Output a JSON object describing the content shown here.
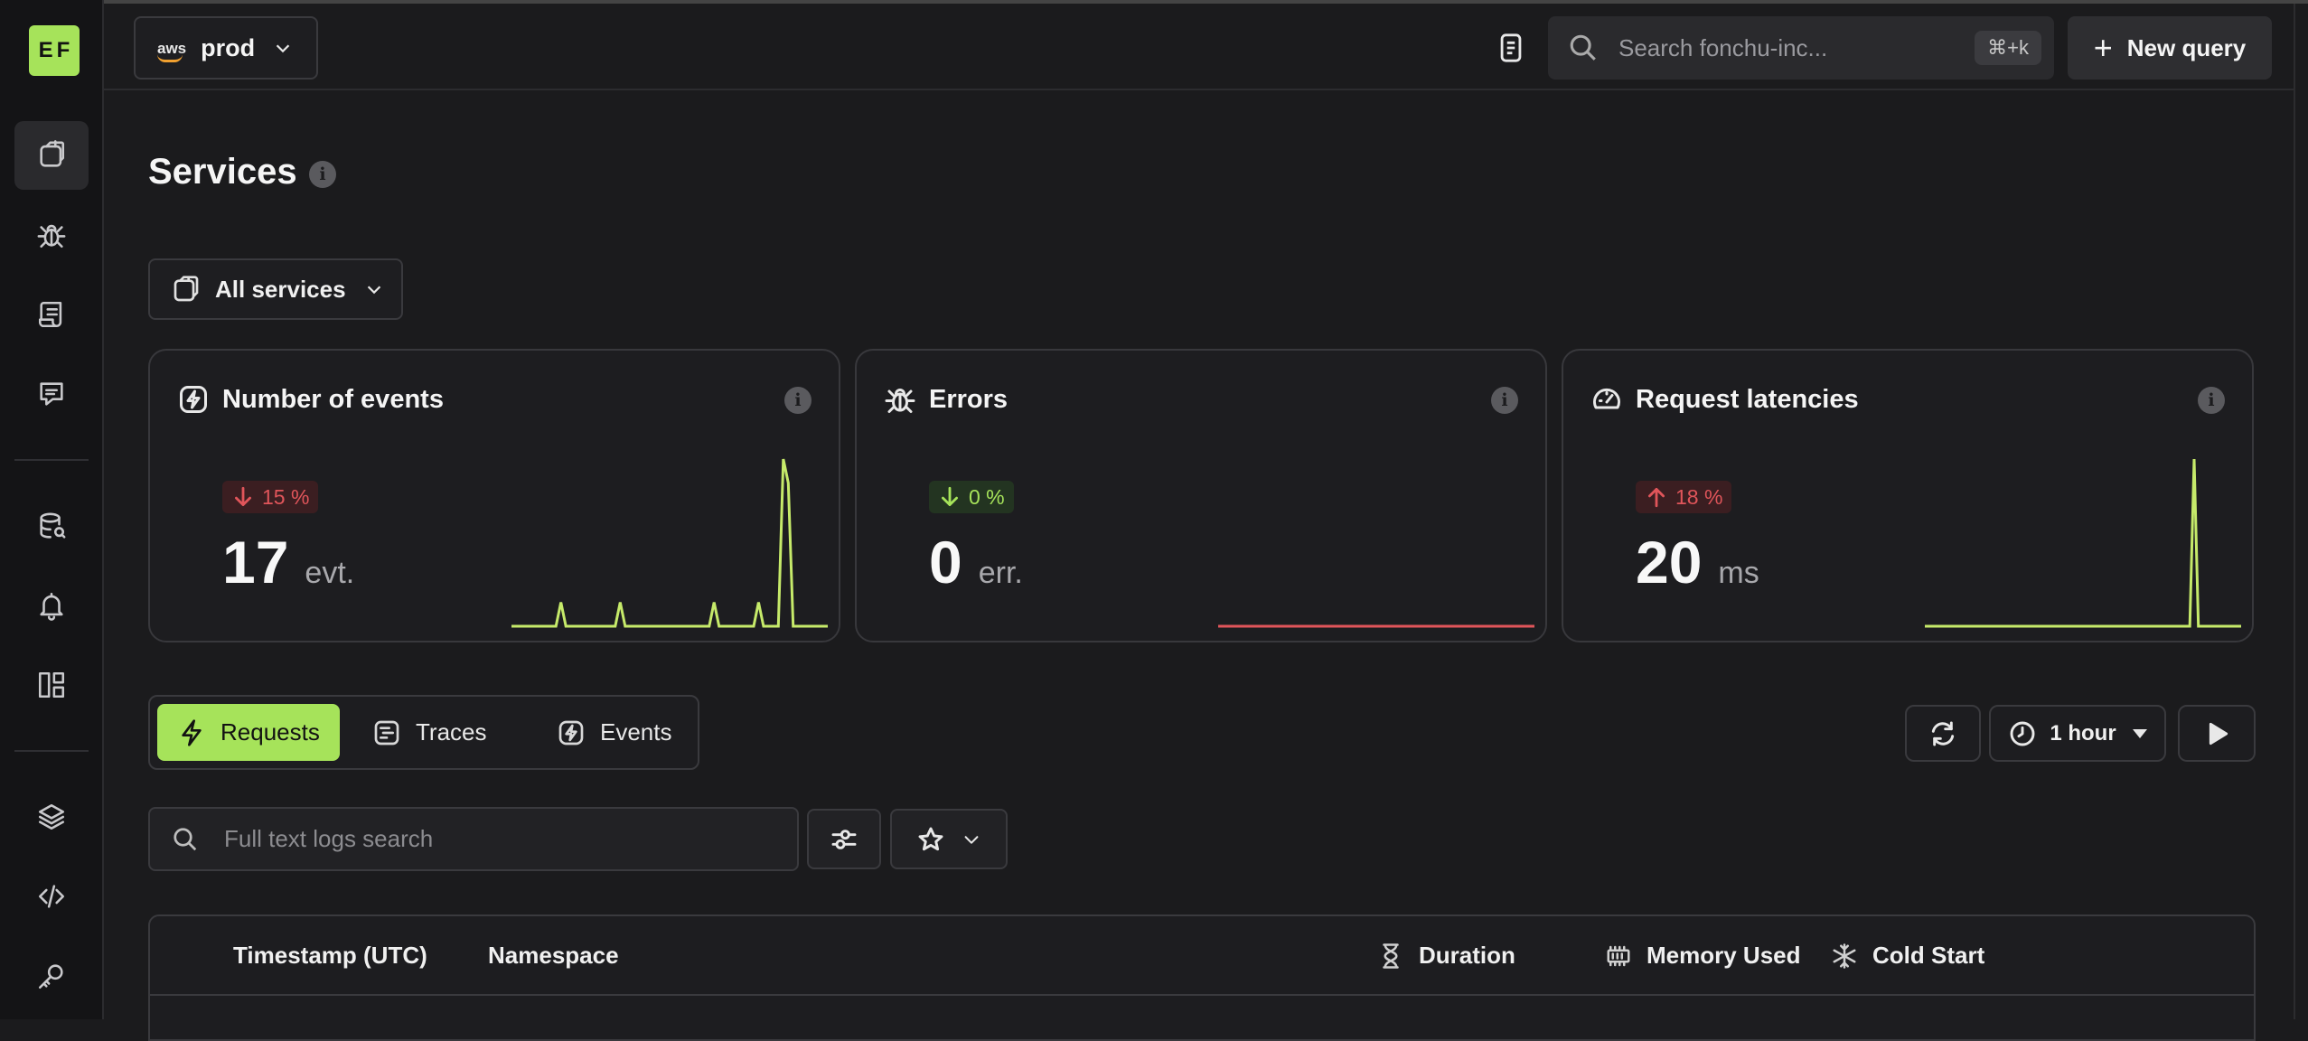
{
  "logo": "EF",
  "topbar": {
    "provider": "aws",
    "environment": "prod",
    "search_placeholder": "Search fonchu-inc...",
    "search_shortcut": "⌘+k",
    "new_query_label": "New query"
  },
  "page": {
    "title": "Services",
    "service_filter": "All services"
  },
  "cards": [
    {
      "title": "Number of events",
      "trend": "15 %",
      "trend_direction": "down",
      "trend_color": "#e0555a",
      "value": "17",
      "unit": "evt.",
      "spark_color": "#c6ea6a",
      "spark": [
        0,
        0,
        0,
        0,
        0,
        0,
        0,
        0,
        0,
        0,
        1,
        0,
        0,
        0,
        0,
        0,
        0,
        0,
        0,
        0,
        0,
        0,
        1,
        0,
        0,
        0,
        0,
        0,
        0,
        0,
        0,
        0,
        0,
        0,
        0,
        0,
        0,
        0,
        0,
        0,
        0,
        1,
        0,
        0,
        0,
        0,
        0,
        0,
        0,
        0,
        1,
        0,
        0,
        0,
        0,
        7,
        6,
        0,
        0,
        0,
        0,
        0,
        0,
        0,
        0
      ]
    },
    {
      "title": "Errors",
      "trend": "0 %",
      "trend_direction": "down",
      "trend_color": "#a6e35a",
      "value": "0",
      "unit": "err.",
      "spark_color": "#e0555a",
      "spark": [
        0,
        0,
        0,
        0,
        0,
        0,
        0,
        0,
        0,
        0,
        0,
        0,
        0,
        0,
        0,
        0,
        0,
        0,
        0,
        0
      ]
    },
    {
      "title": "Request latencies",
      "trend": "18 %",
      "trend_direction": "up",
      "trend_color": "#e0555a",
      "value": "20",
      "unit": "ms",
      "spark_color": "#c6ea6a",
      "spark": [
        0,
        0,
        0,
        0,
        0,
        0,
        0,
        0,
        0,
        0,
        0,
        0,
        0,
        0,
        0,
        0,
        0,
        0,
        0,
        0,
        0,
        0,
        0,
        0,
        0,
        0,
        0,
        0,
        0,
        0,
        0,
        0,
        0,
        0,
        0,
        0,
        0,
        0,
        0,
        0,
        0,
        0,
        0,
        0,
        0,
        0,
        0,
        0,
        0,
        0,
        0,
        0,
        0,
        0,
        0,
        0,
        0,
        0,
        0,
        0,
        0,
        0,
        0,
        20,
        0,
        0,
        0,
        0,
        0,
        0,
        0,
        0,
        0,
        0,
        0
      ]
    }
  ],
  "tabs": [
    {
      "label": "Requests",
      "icon": "bolt-icon",
      "active": true
    },
    {
      "label": "Traces",
      "icon": "traces-icon",
      "active": false
    },
    {
      "label": "Events",
      "icon": "event-icon",
      "active": false
    }
  ],
  "controls": {
    "time_range": "1 hour"
  },
  "logs": {
    "search_placeholder": "Full text logs search"
  },
  "table": {
    "columns": [
      "Timestamp (UTC)",
      "Namespace",
      "Duration",
      "Memory Used",
      "Cold Start"
    ]
  }
}
